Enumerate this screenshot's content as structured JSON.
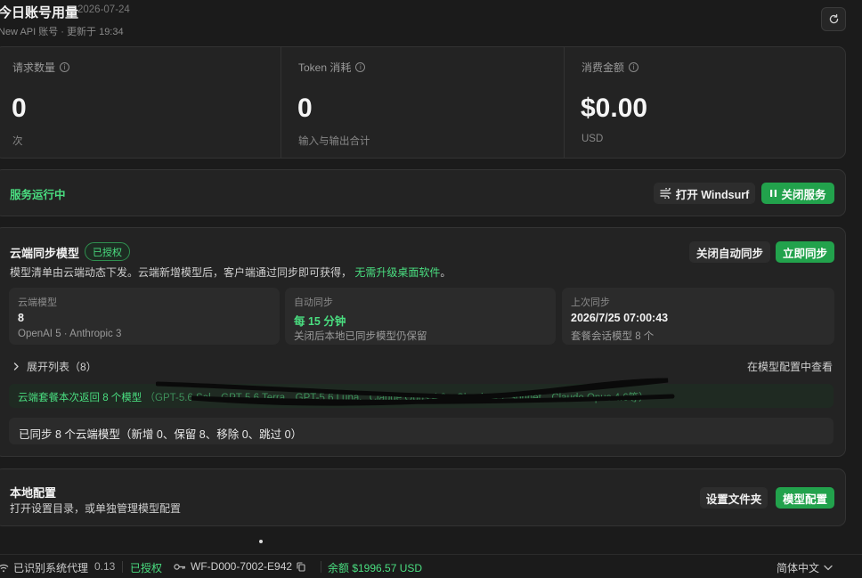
{
  "header": {
    "title": "今日账号用量",
    "date": "2026-07-24",
    "subtitle": "New API 账号 · 更新于 19:34"
  },
  "stats": [
    {
      "label": "请求数量",
      "value": "0",
      "unit": "次"
    },
    {
      "label": "Token 消耗",
      "value": "0",
      "unit": "输入与输出合计"
    },
    {
      "label": "消费金额",
      "value": "$0.00",
      "unit": "USD"
    }
  ],
  "service": {
    "status": "服务运行中",
    "open_label": "打开 Windsurf",
    "close_label": "关闭服务"
  },
  "cloud": {
    "title": "云端同步模型",
    "badge": "已授权",
    "desc": "模型清单由云端动态下发。云端新增模型后，客户端通过同步即可获得，",
    "desc_highlight": "无需升级桌面软件",
    "desc_end": "。",
    "toggle_label": "关闭自动同步",
    "sync_label": "立即同步",
    "cards": [
      {
        "label": "云端模型",
        "value": "8",
        "note": "OpenAI 5 · Anthropic 3"
      },
      {
        "label": "自动同步",
        "value": "每 15 分钟",
        "note": "关闭后本地已同步模型仍保留"
      },
      {
        "label": "上次同步",
        "value": "2026/7/25 07:00:43",
        "note": "套餐会话模型 8 个"
      }
    ],
    "expand_label": "展开列表（8）",
    "view_link": "在模型配置中查看",
    "notice": "云端套餐本次返回 8 个模型",
    "notice_models": "（GPT-5.6 Sol、GPT-5.6 Terra、GPT-5.6 Luna、Claude Opus 4.8、Claude 4.7 Sonnet、Claude Opus 4.6等）",
    "sync_result": "已同步 8 个云端模型（新增 0、保留 8、移除 0、跳过 0）"
  },
  "local": {
    "title": "本地配置",
    "desc": "打开设置目录，或单独管理模型配置",
    "folder_label": "设置文件夹",
    "model_label": "模型配置"
  },
  "footer": {
    "proxy": "已识别系统代理",
    "version": "0.13",
    "auth": "已授权",
    "license": "WF-D000-7002-E942",
    "balance": "余额 $1996.57 USD",
    "language": "简体中文"
  },
  "colors": {
    "accent": "#22a24c",
    "accent_text": "#4ade80",
    "background": "#1b1b1b",
    "card": "#232323"
  }
}
